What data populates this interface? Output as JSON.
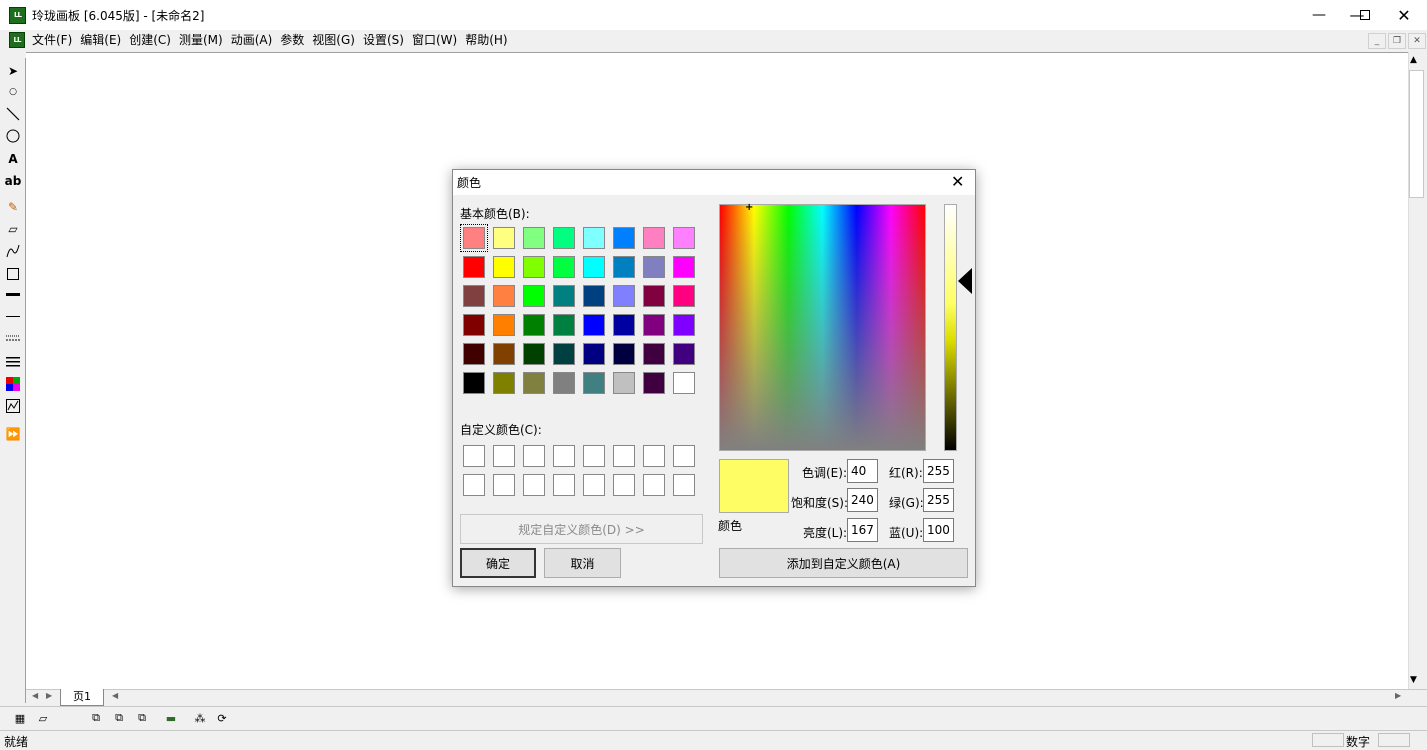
{
  "window": {
    "title": "玲珑画板 [6.045版] - [未命名2]",
    "icon_text": "LL"
  },
  "menu": [
    "文件(F)",
    "编辑(E)",
    "创建(C)",
    "测量(M)",
    "动画(A)",
    "参数",
    "视图(G)",
    "设置(S)",
    "窗口(W)",
    "帮助(H)"
  ],
  "pagebar": {
    "tab": "页1"
  },
  "status": {
    "left": "就绪",
    "right": "数字"
  },
  "dialog": {
    "title": "颜色",
    "basic_label": "基本颜色(B):",
    "custom_label": "自定义颜色(C):",
    "define_custom_button": "规定自定义颜色(D) >>",
    "ok_button": "确定",
    "cancel_button": "取消",
    "preview_label": "颜色",
    "add_custom_button": "添加到自定义颜色(A)",
    "fields": {
      "hue": {
        "label": "色调(E):",
        "value": "40"
      },
      "sat": {
        "label": "饱和度(S):",
        "value": "240"
      },
      "lum": {
        "label": "亮度(L):",
        "value": "167"
      },
      "red": {
        "label": "红(R):",
        "value": "255"
      },
      "green": {
        "label": "绿(G):",
        "value": "255"
      },
      "blue": {
        "label": "蓝(U):",
        "value": "100"
      }
    },
    "selected_color": "#fefe64",
    "basic_colors": [
      "#ff8080",
      "#ffff80",
      "#80ff80",
      "#00ff80",
      "#80ffff",
      "#0080ff",
      "#ff80c0",
      "#ff80ff",
      "#ff0000",
      "#ffff00",
      "#80ff00",
      "#00ff40",
      "#00ffff",
      "#0080c0",
      "#8080c0",
      "#ff00ff",
      "#804040",
      "#ff8040",
      "#00ff00",
      "#008080",
      "#004080",
      "#8080ff",
      "#800040",
      "#ff0080",
      "#800000",
      "#ff8000",
      "#008000",
      "#008040",
      "#0000ff",
      "#0000a0",
      "#800080",
      "#8000ff",
      "#400000",
      "#804000",
      "#004000",
      "#004040",
      "#000080",
      "#000040",
      "#400040",
      "#400080",
      "#000000",
      "#808000",
      "#808040",
      "#808080",
      "#408080",
      "#c0c0c0",
      "#400040",
      "#ffffff"
    ]
  }
}
